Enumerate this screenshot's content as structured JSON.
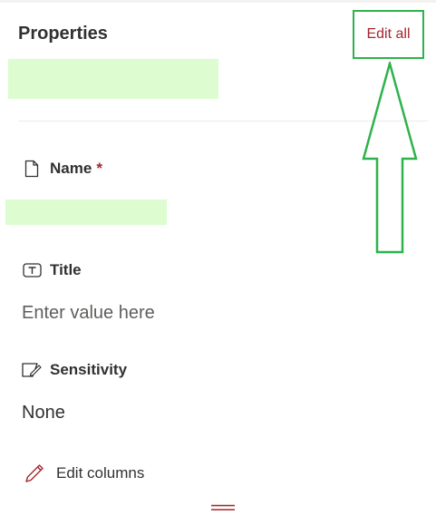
{
  "panel": {
    "title": "Properties",
    "edit_all_label": "Edit all"
  },
  "fields": {
    "name": {
      "label": "Name",
      "required_marker": "*",
      "icon": "document-icon"
    },
    "title": {
      "label": "Title",
      "placeholder": "Enter value here",
      "icon": "text-field-icon"
    },
    "sensitivity": {
      "label": "Sensitivity",
      "value": "None",
      "icon": "sensitivity-label-icon"
    }
  },
  "footer": {
    "edit_columns_label": "Edit columns",
    "icon": "pencil-icon"
  },
  "colors": {
    "accent": "#a4262c",
    "annotation": "#2fb24c",
    "redaction": "#ddfdd0",
    "text": "#323130",
    "placeholder": "#605e5c"
  }
}
